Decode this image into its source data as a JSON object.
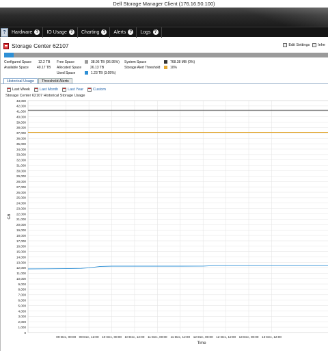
{
  "window": {
    "title": "Dell Storage Manager Client (176.16.50.100)"
  },
  "nav": {
    "help_label": "?",
    "items": [
      {
        "label": "Hardware"
      },
      {
        "label": "IO Usage"
      },
      {
        "label": "Charting"
      },
      {
        "label": "Alerts"
      },
      {
        "label": "Logs"
      }
    ]
  },
  "storage_center": {
    "title": "Storage Center 62107",
    "actions": {
      "edit_settings": "Edit Settings",
      "partial_action": "Inhe"
    },
    "used_fraction": 0.0305,
    "colors": {
      "used": "#2d8fd5",
      "free": "#9a9a9a",
      "system": "#333333",
      "threshold": "#e3a832"
    }
  },
  "stats": {
    "configured_space_label": "Configured Space",
    "configured_space_value": "12.2 TB",
    "available_space_label": "Available Space",
    "available_space_value": "40.17 TB",
    "free_space_label": "Free Space",
    "free_space_value": "38.95 TB  (96.95%)",
    "allocated_space_label": "Allocated Space",
    "allocated_space_value": "26.13 TB",
    "used_space_label": "Used Space",
    "used_space_value": "1.23 TB  (3.05%)",
    "system_space_label": "System Space",
    "system_space_value": "768.38 MB  (0%)",
    "alert_threshold_label": "Storage Alert Threshold",
    "alert_threshold_value": "10%"
  },
  "tabs": [
    {
      "label": "Historical Usage",
      "active": true
    },
    {
      "label": "Threshold Alerts",
      "active": false
    }
  ],
  "range": {
    "options": [
      {
        "label": "Last Week",
        "selected": true
      },
      {
        "label": "Last Month",
        "selected": false
      },
      {
        "label": "Last Year",
        "selected": false
      },
      {
        "label": "Custom",
        "selected": false
      }
    ]
  },
  "chart_data": {
    "type": "line",
    "title": "Storage Center 62107 Historical Storage Usage",
    "xlabel": "Time",
    "ylabel": "GB",
    "ylim": [
      0,
      43000
    ],
    "ytick_step": 1000,
    "x_ticks": [
      "09-Dec, 00:00",
      "09-Dec, 12:00",
      "10-Dec, 00:00",
      "10-Dec, 12:00",
      "11-Dec, 00:00",
      "11-Dec, 12:00",
      "12-Dec, 00:00",
      "12-Dec, 12:00",
      "13-Dec, 00:00",
      "13-Dec, 12:00"
    ],
    "x_range_hours": [
      -20,
      138
    ],
    "grid": true,
    "series": [
      {
        "color": "#555555",
        "points": [
          [
            -20,
            41200
          ],
          [
            138,
            41200
          ]
        ]
      },
      {
        "color": "#e3a832",
        "points": [
          [
            -20,
            37100
          ],
          [
            138,
            37100
          ]
        ]
      },
      {
        "color": "#2d8fd5",
        "points": [
          [
            -20,
            11800
          ],
          [
            -10,
            11820
          ],
          [
            0,
            11850
          ],
          [
            8,
            11900
          ],
          [
            12,
            12000
          ],
          [
            18,
            12250
          ],
          [
            24,
            12300
          ],
          [
            40,
            12300
          ],
          [
            60,
            12300
          ],
          [
            72,
            12320
          ],
          [
            78,
            12400
          ],
          [
            96,
            12400
          ],
          [
            120,
            12400
          ],
          [
            138,
            12400
          ]
        ]
      }
    ]
  }
}
